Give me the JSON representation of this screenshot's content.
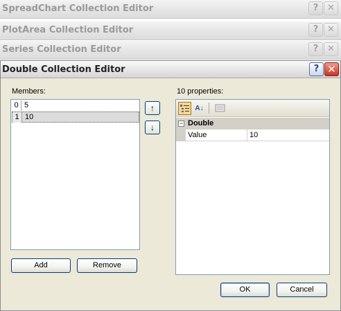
{
  "background_windows": [
    {
      "title": "SpreadChart Collection Editor"
    },
    {
      "title": "PlotArea Collection Editor"
    },
    {
      "title": "Series Collection Editor"
    }
  ],
  "dialog": {
    "title": "Double Collection Editor",
    "help_glyph": "?",
    "close_glyph": "✕",
    "members_label": "Members:",
    "members": [
      {
        "index": "0",
        "value": "5"
      },
      {
        "index": "1",
        "value": "10",
        "selected": true
      }
    ],
    "move_up_glyph": "↑",
    "move_down_glyph": "↓",
    "add_label": "Add",
    "remove_label": "Remove",
    "properties_label": "10 properties:",
    "toolbar": {
      "categorized_icon": "categorized-icon",
      "alphabetical_glyph": "A↓",
      "property_pages_icon": "property-pages-icon"
    },
    "property_grid": {
      "category": "Double",
      "collapse_glyph": "−",
      "rows": [
        {
          "name": "Value",
          "value": "10"
        }
      ]
    },
    "ok_label": "OK",
    "cancel_label": "Cancel"
  },
  "colors": {
    "dialog_face": "#ece9d8",
    "close_button": "#c8341f",
    "selection": "#dcdcdc"
  }
}
